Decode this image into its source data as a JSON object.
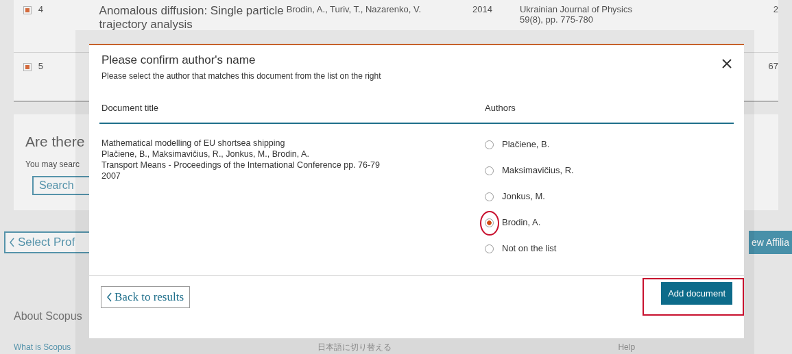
{
  "background": {
    "rows": [
      {
        "checked": true,
        "number": "4",
        "title": "Anomalous diffusion: Single particle",
        "title_line_2": "trajectory analysis",
        "authors": "Brodin, A., Turiv, T., Nazarenko, V.",
        "year": "2014",
        "source": "Ukrainian Journal of Physics",
        "source_line_2": "59(8), pp. 775-780",
        "column_7": "2"
      },
      {
        "checked": true,
        "number": "5",
        "title": "",
        "title_line_2": "",
        "authors": "",
        "year": "",
        "source": "",
        "source_line_2": "",
        "column_7": "67"
      }
    ],
    "section_heading": "Are there",
    "section_text": "You may searc",
    "search_button": "Search",
    "back_button": "Select Prof",
    "right_button": "ew Affilia",
    "footer_heading": "About Scopus",
    "footer_links": [
      "What is Scopus",
      "日本語に切り替える",
      "Help"
    ]
  },
  "dialog": {
    "title": "Please confirm author's name",
    "subtitle": "Please select the author that matches this document from the list on the right",
    "columns": [
      "Document title",
      "Authors"
    ],
    "document_lines": [
      "Mathematical modelling of EU shortsea shipping",
      "Plačiene, B., Maksimavičius, R., Jonkus, M., Brodin, A.",
      "Transport Means - Proceedings of the International Conference pp. 76-79",
      "2007"
    ],
    "authors": [
      {
        "name": "Plačiene, B.",
        "selected": false
      },
      {
        "name": "Maksimavičius, R.",
        "selected": false
      },
      {
        "name": "Jonkus, M.",
        "selected": false
      },
      {
        "name": "Brodin, A.",
        "selected": true
      },
      {
        "name": "Not on the list",
        "selected": false
      }
    ],
    "back_button": "Back to results",
    "add_button": "Add document"
  }
}
